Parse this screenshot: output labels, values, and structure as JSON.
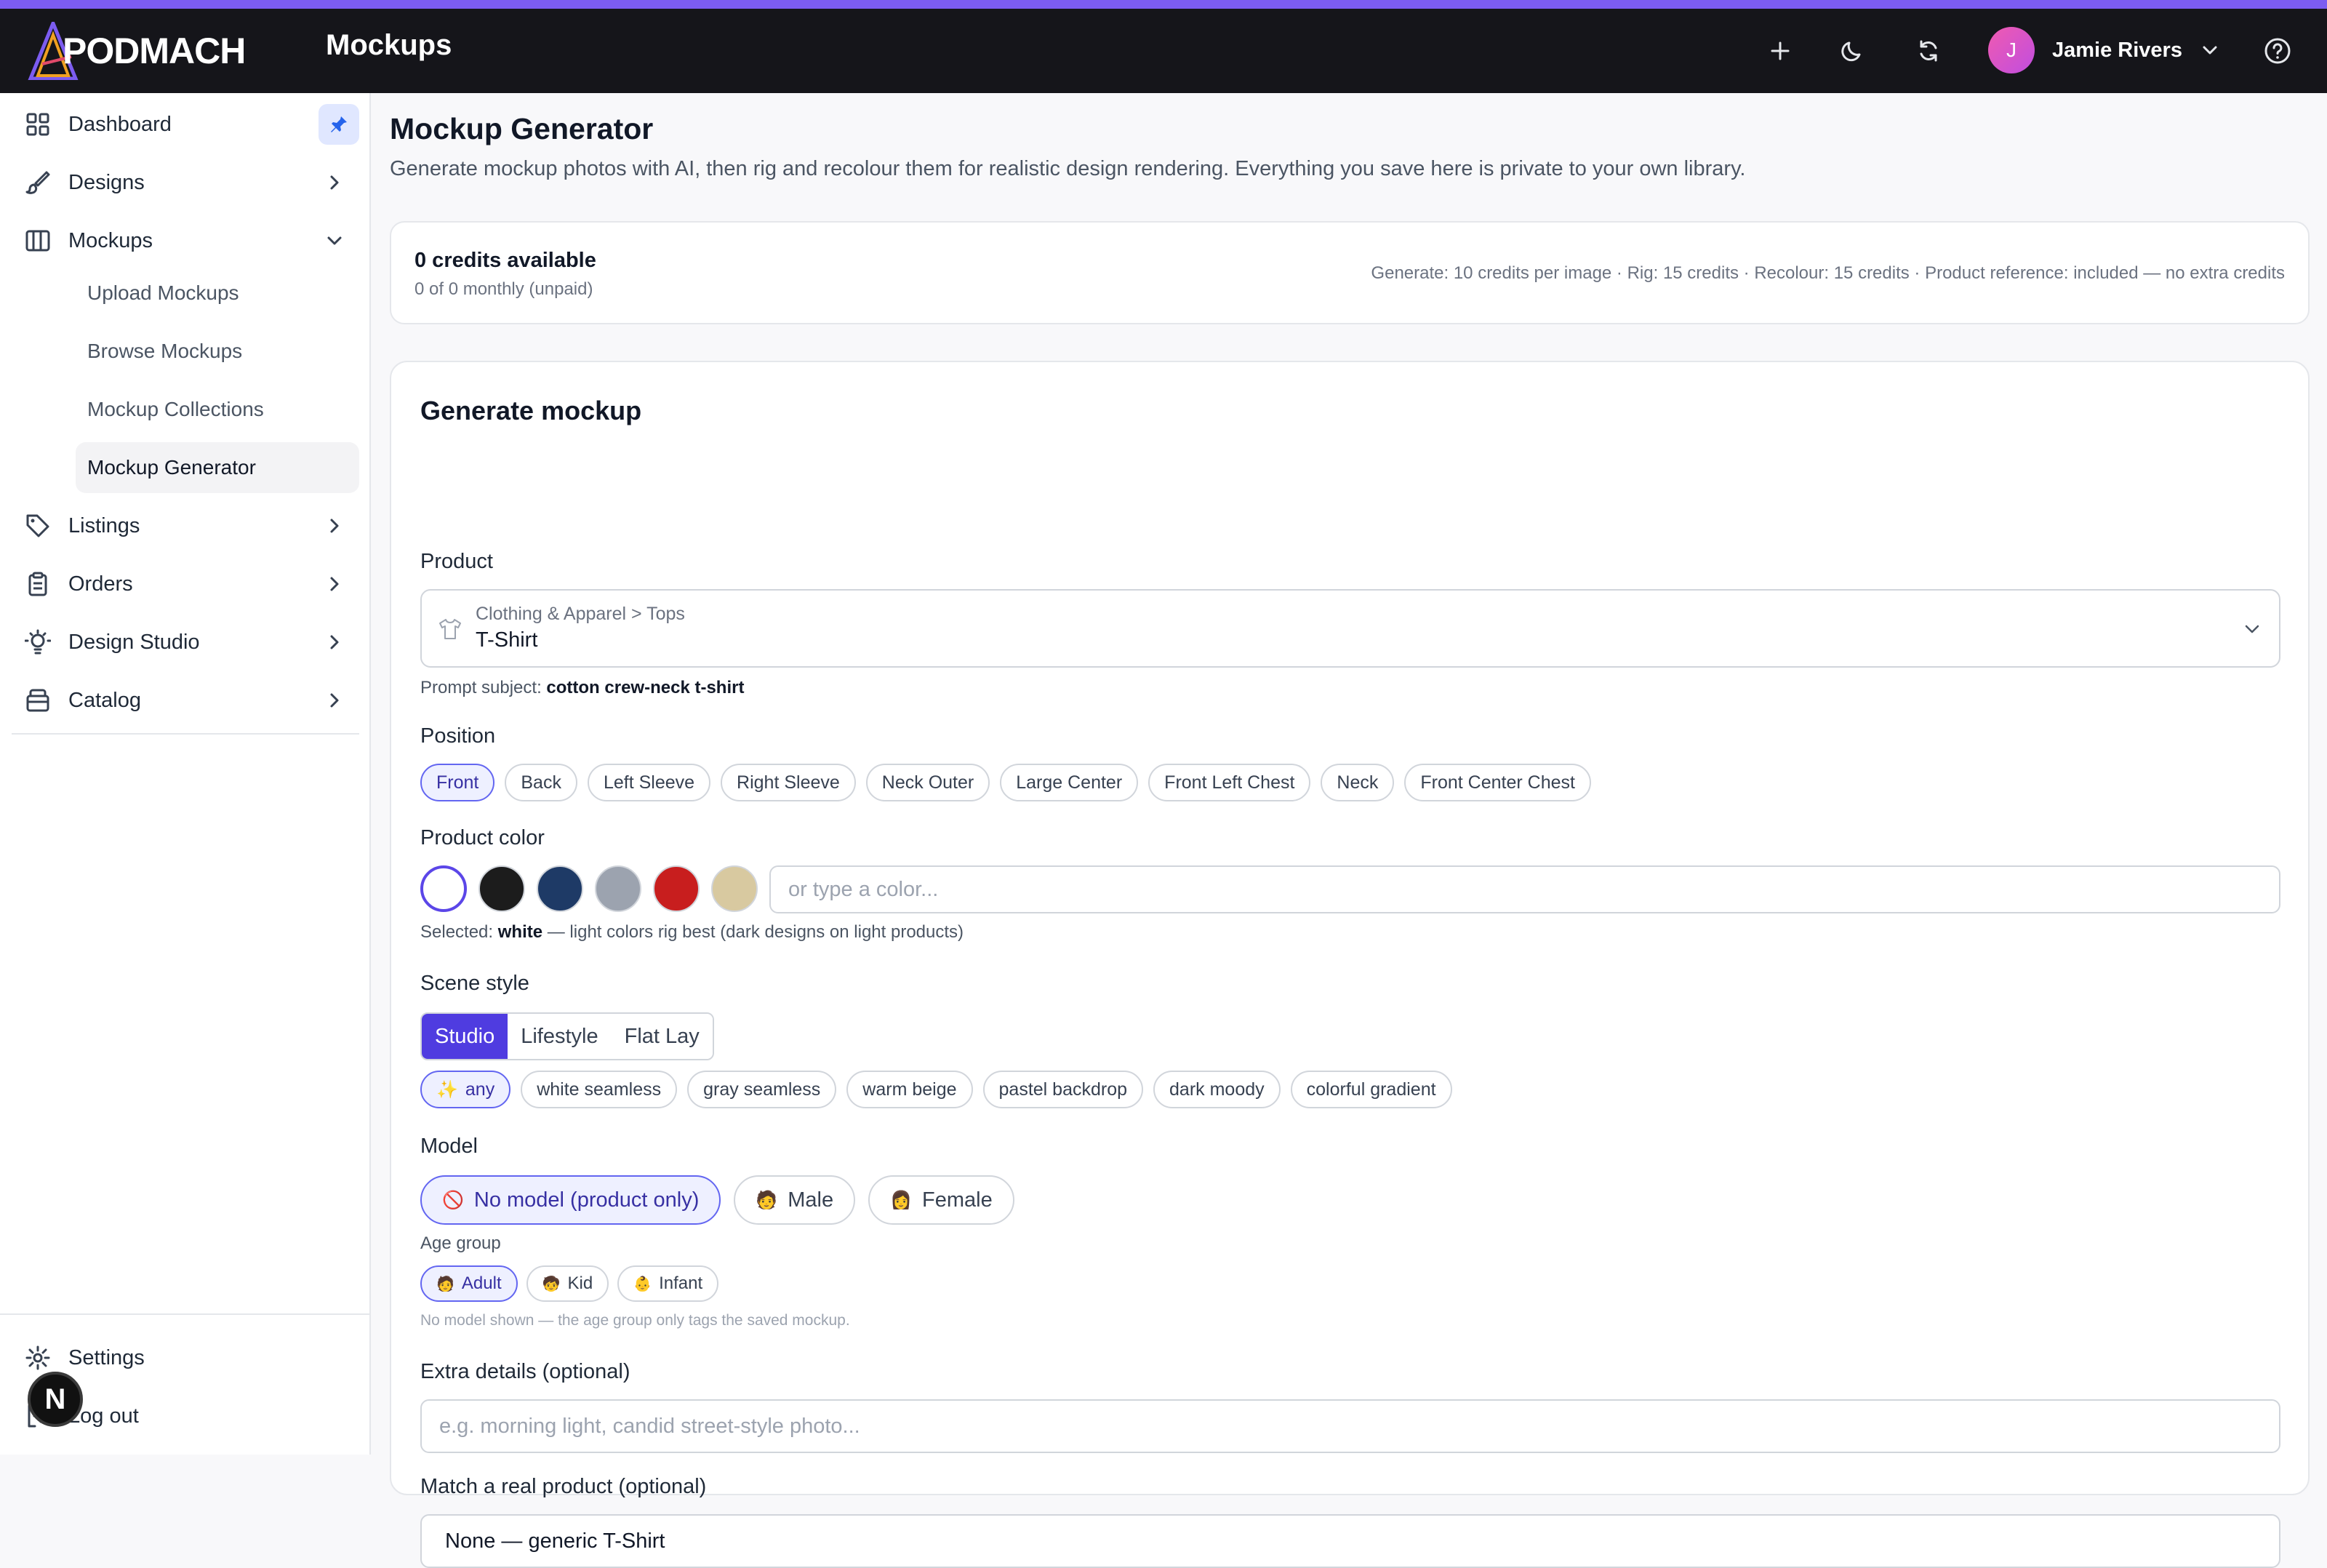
{
  "app": {
    "logo_text": "PODMACH",
    "section_title": "Mockups"
  },
  "topbar": {
    "username": "Jamie Rivers",
    "avatar_initial": "J"
  },
  "sidebar": {
    "items": [
      {
        "label": "Dashboard",
        "icon": "dashboard-icon"
      },
      {
        "label": "Designs",
        "icon": "brush-icon"
      },
      {
        "label": "Mockups",
        "icon": "mockups-icon"
      },
      {
        "label": "Listings",
        "icon": "tag-icon"
      },
      {
        "label": "Orders",
        "icon": "clipboard-icon"
      },
      {
        "label": "Design Studio",
        "icon": "bulb-icon"
      },
      {
        "label": "Catalog",
        "icon": "box-icon"
      }
    ],
    "mockup_subitems": [
      "Upload Mockups",
      "Browse Mockups",
      "Mockup Collections",
      "Mockup Generator"
    ],
    "active_subitem": "Mockup Generator",
    "settings_label": "Settings",
    "logout_label": "Log out",
    "badge_letter": "N"
  },
  "page": {
    "title": "Mockup Generator",
    "description": "Generate mockup photos with AI, then rig and recolour them for realistic design rendering. Everything you save here is private to your own library."
  },
  "credits": {
    "title": "0 credits available",
    "subtitle": "0 of 0 monthly (unpaid)",
    "costs": "Generate: 10 credits per image · Rig: 15 credits · Recolour: 15 credits · Product reference: included — no extra credits"
  },
  "generator": {
    "title": "Generate mockup",
    "product_label": "Product",
    "product_path": "Clothing & Apparel > Tops",
    "product_value": "T-Shirt",
    "prompt_subject_label": "Prompt subject:",
    "prompt_subject_value": "cotton crew-neck t-shirt",
    "position_label": "Position",
    "positions": [
      "Front",
      "Back",
      "Left Sleeve",
      "Right Sleeve",
      "Neck Outer",
      "Large Center",
      "Front Left Chest",
      "Neck",
      "Front Center Chest"
    ],
    "active_position": "Front",
    "color_label": "Product color",
    "colors": [
      "#ffffff",
      "#1c1c1c",
      "#1e3a66",
      "#9ca3af",
      "#c81e1e",
      "#d8c9a0"
    ],
    "color_placeholder": "or type a color...",
    "selected_color_prefix": "Selected:",
    "selected_color": "white",
    "selected_color_note": "— light colors rig best (dark designs on light products)",
    "scene_label": "Scene style",
    "scene_tabs": [
      "Studio",
      "Lifestyle",
      "Flat Lay"
    ],
    "active_scene": "Studio",
    "backdrops": [
      "any",
      "white seamless",
      "gray seamless",
      "warm beige",
      "pastel backdrop",
      "dark moody",
      "colorful gradient"
    ],
    "active_backdrop": "any",
    "model_label": "Model",
    "models": [
      {
        "label": "No model (product only)",
        "emoji": "🚫"
      },
      {
        "label": "Male",
        "emoji": "🧑"
      },
      {
        "label": "Female",
        "emoji": "👩"
      }
    ],
    "active_model": "No model (product only)",
    "age_label": "Age group",
    "ages": [
      {
        "label": "Adult",
        "emoji": "🧑"
      },
      {
        "label": "Kid",
        "emoji": "🧒"
      },
      {
        "label": "Infant",
        "emoji": "👶"
      }
    ],
    "active_age": "Adult",
    "age_note": "No model shown — the age group only tags the saved mockup.",
    "extra_label": "Extra details (optional)",
    "extra_placeholder": "e.g. morning light, candid street-style photo...",
    "match_label": "Match a real product (optional)",
    "match_value": "None — generic T-Shirt"
  },
  "colors": {
    "accent": "#7c5cf0",
    "primary": "#4f3ce0",
    "topbar": "#15151a"
  }
}
